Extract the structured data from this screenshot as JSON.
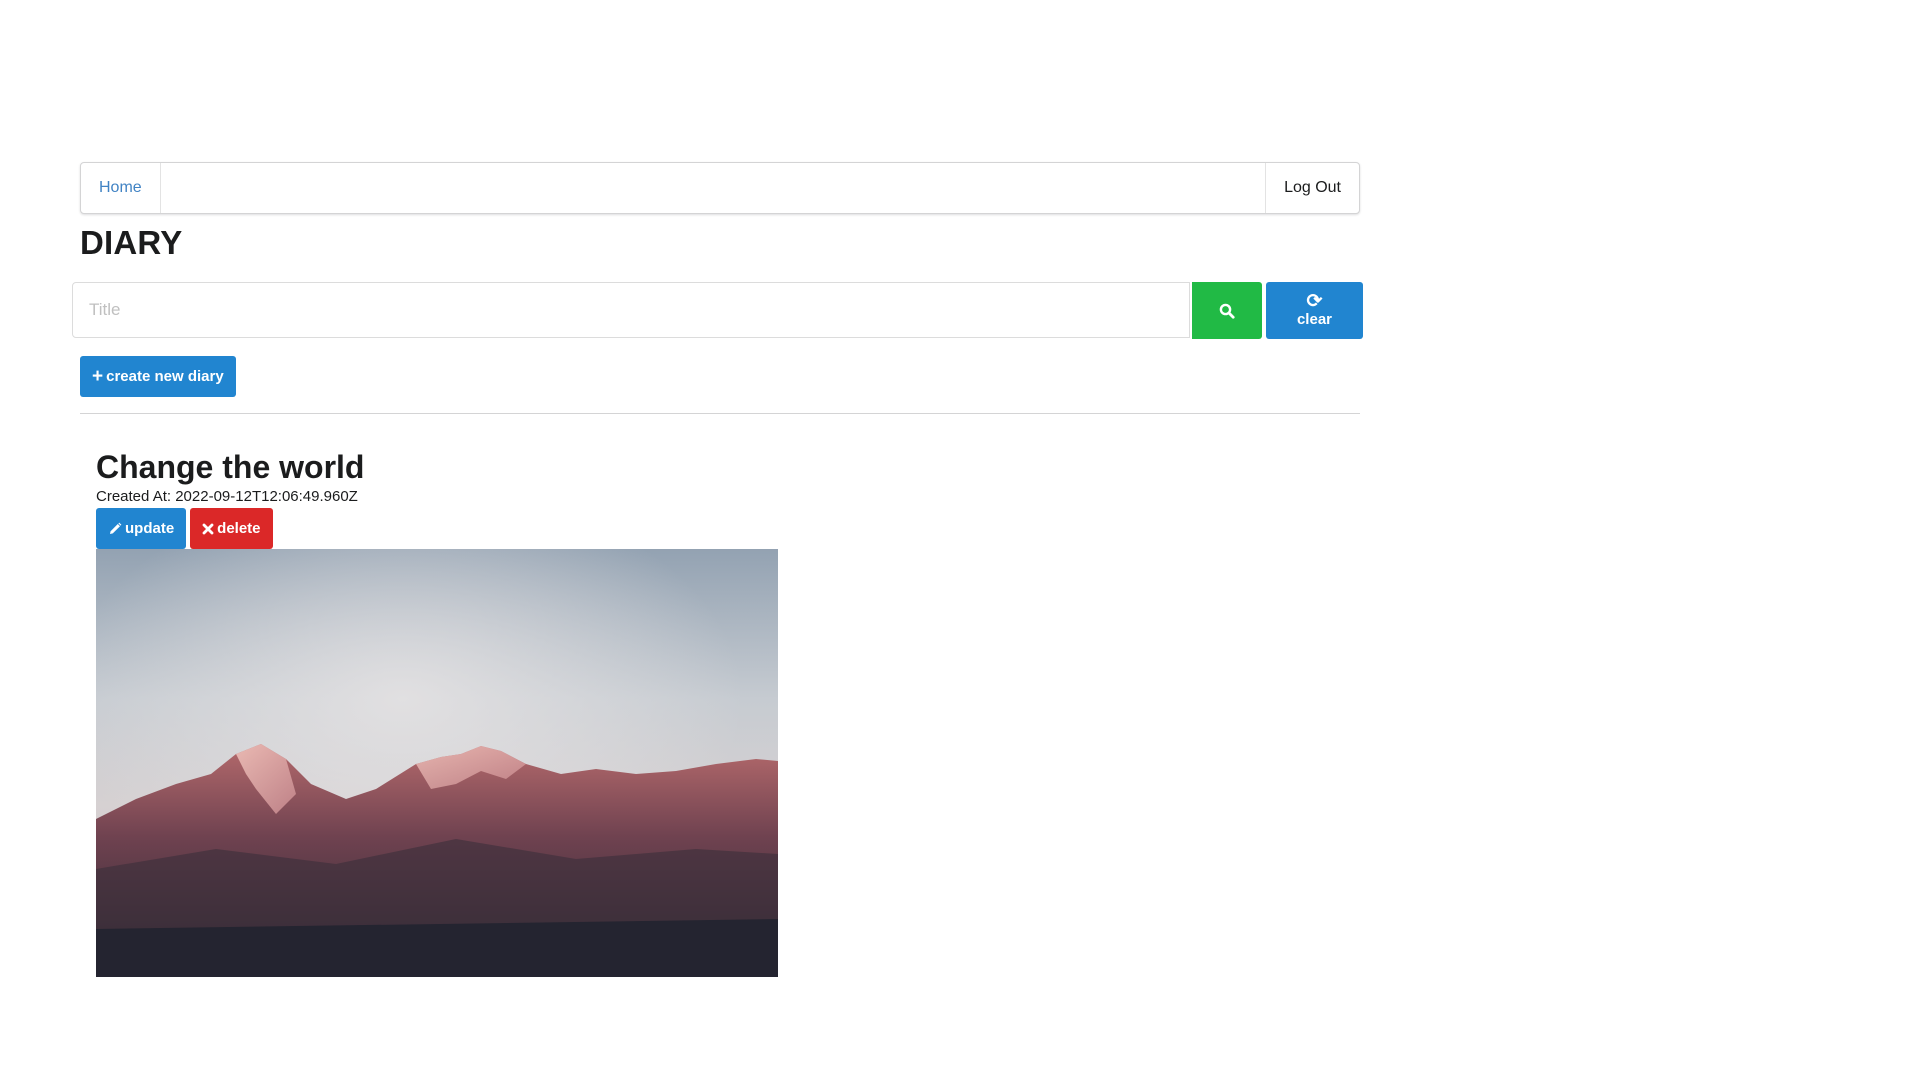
{
  "nav": {
    "home_label": "Home",
    "logout_label": "Log Out"
  },
  "page": {
    "title": "DIARY"
  },
  "search": {
    "placeholder": "Title",
    "value": "",
    "clear_label": "clear"
  },
  "actions": {
    "create_label": "create new diary"
  },
  "entries": [
    {
      "title": "Change the world",
      "created_at": "Created At: 2022-09-12T12:06:49.960Z",
      "update_label": "update",
      "delete_label": "delete"
    }
  ],
  "colors": {
    "primary": "#2185d0",
    "success": "#21ba45",
    "danger": "#db2828",
    "link": "#4183c4"
  },
  "icons": {
    "search": "search-icon",
    "clear": "refresh-icon",
    "create": "plus-icon",
    "update": "pencil-icon",
    "delete": "close-icon"
  }
}
